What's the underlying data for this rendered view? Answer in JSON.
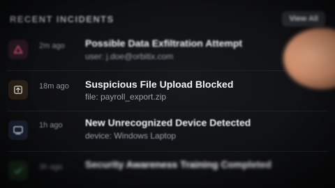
{
  "header": {
    "title": "RECENT INCIDENTS",
    "view_all_label": "View All"
  },
  "incidents": [
    {
      "time": "2m ago",
      "title": "Possible Data Exfiltration Attempt",
      "detail": "user: j.doe@orbitix.com",
      "icon": "warning-triangle-icon",
      "color": "#e0557a"
    },
    {
      "time": "18m ago",
      "title": "Suspicious File Upload Blocked",
      "detail": "file: payroll_export.zip",
      "icon": "upload-icon",
      "color": "#e3a24a"
    },
    {
      "time": "1h ago",
      "title": "New Unrecognized Device Detected",
      "detail": "device: Windows Laptop",
      "icon": "device-icon",
      "color": "#6f93c8"
    },
    {
      "time": "3h ago",
      "title": "Security Awareness Training Completed",
      "detail": "",
      "icon": "check-icon",
      "color": "#4caf6a"
    }
  ]
}
